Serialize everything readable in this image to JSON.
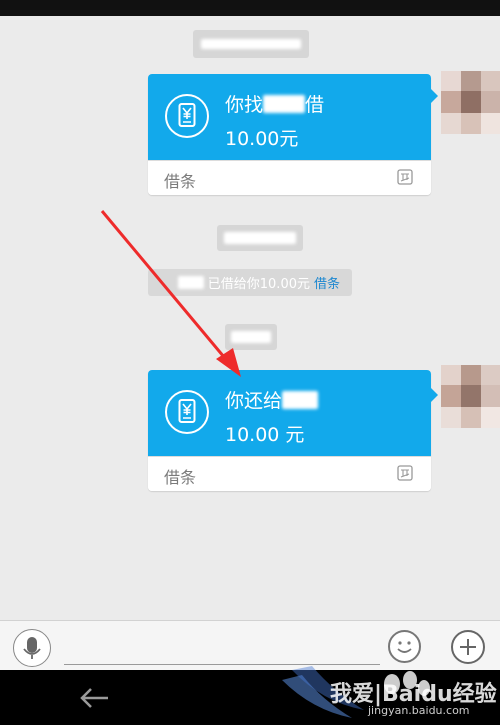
{
  "cards": [
    {
      "title_prefix": "你找",
      "title_suffix": "借",
      "amount": "10.00元",
      "label": "借条"
    },
    {
      "title_prefix": "你还给",
      "title_suffix": "",
      "amount": "10.00 元",
      "label": "借条"
    }
  ],
  "notice": {
    "text": "已借给你10.00元",
    "link": "借条"
  },
  "watermark": {
    "line1": "我爱|Baidu经验",
    "line2": "jingyan.baidu.com"
  },
  "colors": {
    "card_blue": "#12a9eb",
    "link_blue": "#1e88d0",
    "arrow_red": "#ee2b2b"
  },
  "icons": {
    "card": "receipt-yen-icon",
    "app": "app-logo-icon",
    "voice": "microphone-icon",
    "emoji": "smiley-icon",
    "more": "plus-icon",
    "back": "back-arrow-icon"
  }
}
